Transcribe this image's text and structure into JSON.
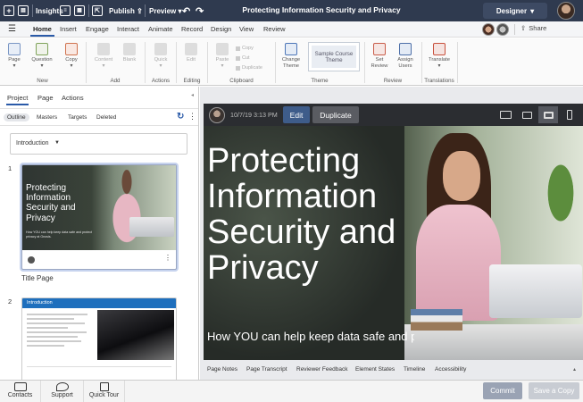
{
  "topbar": {
    "insights_label": "Insights",
    "publish_label": "Publish",
    "preview_label": "Preview",
    "document_title": "Protecting Information Security and Privacy",
    "mode_label": "Designer"
  },
  "menu": {
    "tabs": [
      "Home",
      "Insert",
      "Engage",
      "Interact",
      "Animate",
      "Record",
      "Design",
      "View",
      "Review"
    ],
    "share_label": "Share"
  },
  "ribbon": {
    "buttons": {
      "page": "Page",
      "question": "Question",
      "copy": "Copy",
      "content": "Content",
      "blank": "Blank",
      "quick": "Quick",
      "edit": "Edit",
      "paste": "Paste",
      "copy_small": "Copy",
      "cut": "Cut",
      "duplicate": "Duplicate",
      "change_theme": "Change Theme",
      "set_review": "Set Review",
      "assign_users": "Assign Users",
      "translate": "Translate"
    },
    "theme_preview": "Sample Course Theme",
    "groups": [
      "New",
      "Add",
      "Actions",
      "Editing",
      "Clipboard",
      "Theme",
      "Review",
      "Translations"
    ]
  },
  "left_panel": {
    "tabs": [
      "Project",
      "Page",
      "Actions"
    ],
    "subtabs": [
      "Outline",
      "Masters",
      "Targets",
      "Deleted"
    ],
    "section_select": "Introduction",
    "pages": [
      {
        "number": "1",
        "label": "Title Page",
        "thumb_title": "Protecting Information Security and Privacy",
        "thumb_subtitle": "How YOU can help keep data safe and protect privacy at Gnosis."
      },
      {
        "number": "2",
        "thumb_header": "Introduction"
      }
    ]
  },
  "stage": {
    "timestamp": "10/7/19 3:13 PM",
    "edit_label": "Edit",
    "duplicate_label": "Duplicate",
    "slide_title": "Protecting Information Security and Privacy",
    "slide_subtitle": "How YOU can help keep data safe and protect privacy at Gnosis.",
    "bottom_tabs": [
      "Page Notes",
      "Page Transcript",
      "Reviewer Feedback",
      "Element States",
      "Timeline",
      "Accessibility"
    ]
  },
  "footer": {
    "contacts": "Contacts",
    "support": "Support",
    "quick_tour": "Quick Tour",
    "commit": "Commit",
    "save_copy": "Save a Copy"
  },
  "colors": {
    "topbar": "#2f3a4f",
    "accent": "#2a5aa8",
    "edit_button": "#3e5c8a",
    "commit_button": "#9aa3b4"
  }
}
